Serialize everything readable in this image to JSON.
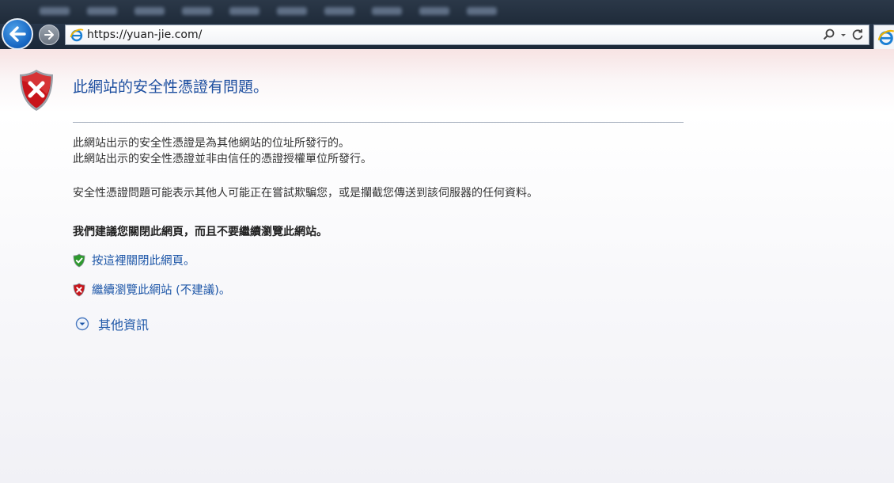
{
  "browser": {
    "url": "https://yuan-jie.com/",
    "back_icon": "back-arrow-icon",
    "forward_icon": "forward-arrow-icon",
    "search_icon": "search-icon",
    "refresh_icon": "refresh-icon"
  },
  "error_page": {
    "title": "此網站的安全性憑證有問題。",
    "line1": "此網站出示的安全性憑證是為其他網站的位址所發行的。",
    "line2": "此網站出示的安全性憑證並非由信任的憑證授權單位所發行。",
    "warning": "安全性憑證問題可能表示其他人可能正在嘗試欺騙您，或是攔截您傳送到該伺服器的任何資料。",
    "recommendation": "我們建議您關閉此網頁，而且不要繼續瀏覽此網站。",
    "close_link": "按這裡關閉此網頁。",
    "continue_link": "繼續瀏覽此網站 (不建議)。",
    "more_info": "其他資訊"
  },
  "colors": {
    "link": "#1e57a8",
    "title": "#1e4fa0",
    "shield_red": "#c8151b",
    "shield_green": "#2e9a2e"
  }
}
